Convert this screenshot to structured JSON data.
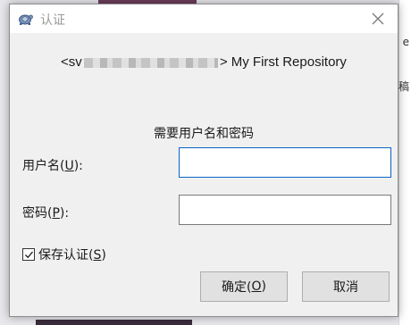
{
  "background": {
    "right_text_1": "e",
    "right_text_2": "稿"
  },
  "dialog": {
    "title": "认证",
    "repo_prefix": "<sv",
    "repo_suffix": "> My First Repository",
    "prompt": "需要用户名和密码",
    "username": {
      "label_pre": "用户名(",
      "label_key": "U",
      "label_post": "):",
      "value": ""
    },
    "password": {
      "label_pre": "密码(",
      "label_key": "P",
      "label_post": "):",
      "value": ""
    },
    "save_auth": {
      "label_pre": "保存认证(",
      "label_key": "S",
      "label_post": ")",
      "checked": true
    },
    "ok_button": {
      "label_pre": "确定(",
      "label_key": "O",
      "label_post": ")"
    },
    "cancel_button": {
      "label": "取消"
    }
  }
}
